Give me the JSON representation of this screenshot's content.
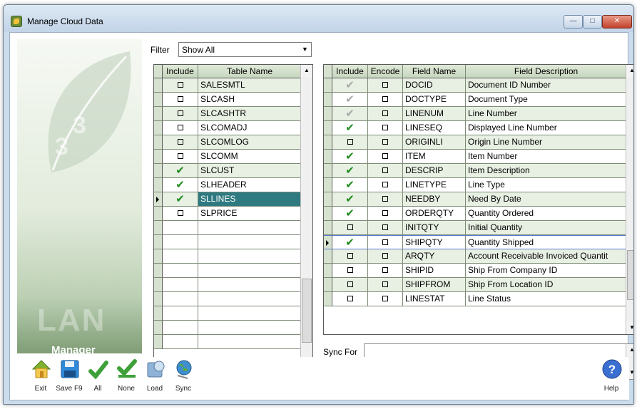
{
  "window": {
    "title": "Manage Cloud Data"
  },
  "branding": {
    "big": "LAN",
    "small": "Manager"
  },
  "filter": {
    "label": "Filter",
    "value": "Show All"
  },
  "tables": {
    "headers": [
      "Include",
      "Table Name"
    ],
    "rows": [
      {
        "include": "unchecked",
        "name": "SALESMTL"
      },
      {
        "include": "unchecked",
        "name": "SLCASH"
      },
      {
        "include": "unchecked",
        "name": "SLCASHTR"
      },
      {
        "include": "unchecked",
        "name": "SLCOMADJ"
      },
      {
        "include": "unchecked",
        "name": "SLCOMLOG"
      },
      {
        "include": "unchecked",
        "name": "SLCOMM"
      },
      {
        "include": "checked",
        "name": "SLCUST"
      },
      {
        "include": "checked",
        "name": "SLHEADER"
      },
      {
        "include": "checked",
        "name": "SLLINES",
        "selected": true
      },
      {
        "include": "unchecked",
        "name": "SLPRICE"
      }
    ]
  },
  "fields": {
    "headers": [
      "Include",
      "Encode",
      "Field Name",
      "Field Description"
    ],
    "rows": [
      {
        "include": "grey",
        "encode": "unchecked",
        "name": "DOCID",
        "desc": "Document ID Number"
      },
      {
        "include": "grey",
        "encode": "unchecked",
        "name": "DOCTYPE",
        "desc": "Document Type"
      },
      {
        "include": "grey",
        "encode": "unchecked",
        "name": "LINENUM",
        "desc": "Line Number"
      },
      {
        "include": "checked",
        "encode": "unchecked",
        "name": "LINESEQ",
        "desc": "Displayed Line Number"
      },
      {
        "include": "unchecked",
        "encode": "unchecked",
        "name": "ORIGINLI",
        "desc": "Origin Line Number"
      },
      {
        "include": "checked",
        "encode": "unchecked",
        "name": "ITEM",
        "desc": "Item Number"
      },
      {
        "include": "checked",
        "encode": "unchecked",
        "name": "DESCRIP",
        "desc": "Item Description"
      },
      {
        "include": "checked",
        "encode": "unchecked",
        "name": "LINETYPE",
        "desc": "Line Type"
      },
      {
        "include": "checked",
        "encode": "unchecked",
        "name": "NEEDBY",
        "desc": "Need By Date"
      },
      {
        "include": "checked",
        "encode": "unchecked",
        "name": "ORDERQTY",
        "desc": "Quantity Ordered"
      },
      {
        "include": "unchecked",
        "encode": "unchecked",
        "name": "INITQTY",
        "desc": "Initial Quantity"
      },
      {
        "include": "checked",
        "encode": "unchecked",
        "name": "SHIPQTY",
        "desc": "Quantity Shipped",
        "active": true
      },
      {
        "include": "unchecked",
        "encode": "unchecked",
        "name": "ARQTY",
        "desc": "Account Receivable Invoiced Quantit"
      },
      {
        "include": "unchecked",
        "encode": "unchecked",
        "name": "SHIPID",
        "desc": "Ship From Company ID"
      },
      {
        "include": "unchecked",
        "encode": "unchecked",
        "name": "SHIPFROM",
        "desc": "Ship From Location ID"
      },
      {
        "include": "unchecked",
        "encode": "unchecked",
        "name": "LINESTAT",
        "desc": "Line Status"
      }
    ]
  },
  "sync": {
    "label": "Sync For",
    "value": ""
  },
  "toolbar": {
    "exit": "Exit",
    "save": "Save F9",
    "all": "All",
    "none": "None",
    "load": "Load",
    "sync": "Sync",
    "help": "Help"
  },
  "colors": {
    "selected_row": "#2f7a80",
    "check_green": "#1e8a1e",
    "check_grey": "#a7a7a7",
    "header_bg": "#c7d7bf",
    "row_alt": "#e8f0e3"
  }
}
